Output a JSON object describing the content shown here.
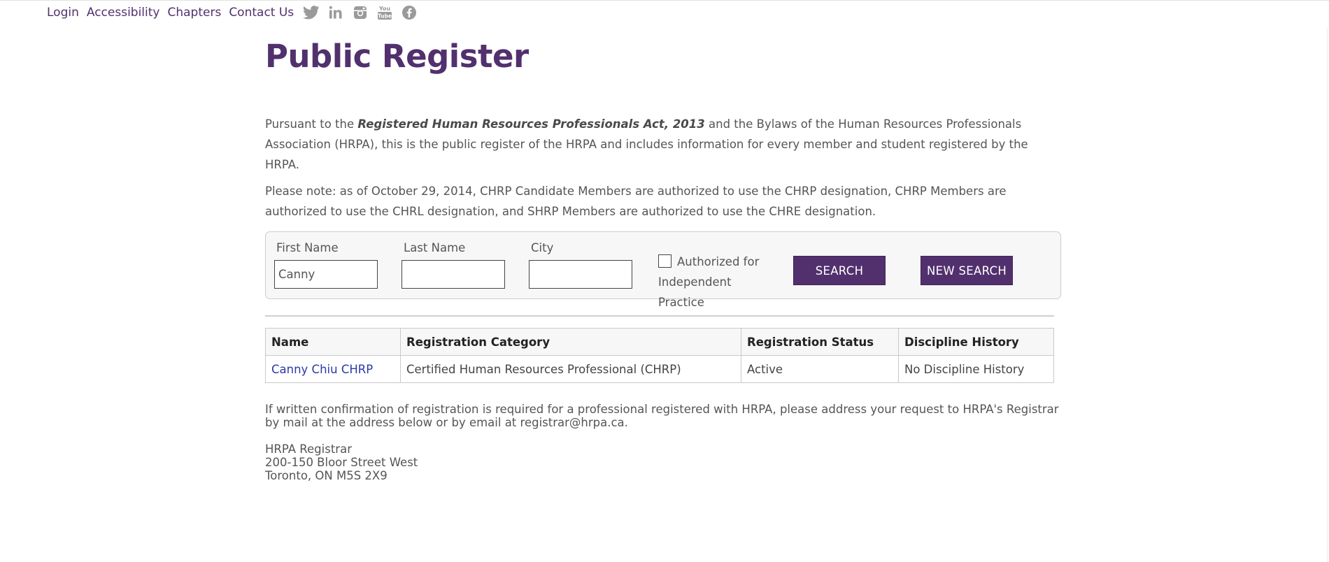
{
  "topnav": {
    "links": [
      "Login",
      "Accessibility",
      "Chapters",
      "Contact Us"
    ],
    "social_icons": [
      "twitter-icon",
      "linkedin-icon",
      "instagram-icon",
      "youtube-icon",
      "facebook-icon"
    ],
    "youtube_text_top": "You",
    "youtube_text_bottom": "Tube"
  },
  "title": "Public Register",
  "intro": {
    "p1_pre": "Pursuant to the ",
    "p1_act": "Registered Human Resources Professionals Act, 2013",
    "p1_post": " and the Bylaws of the Human Resources Professionals Association (HRPA), this is the public register of the HRPA and includes information for every member and student registered by the HRPA.",
    "p2": "Please note: as of October 29, 2014, CHRP Candidate Members are authorized to use the CHRP designation, CHRP Members are authorized to use the CHRL designation, and SHRP Members are authorized to use the CHRE designation."
  },
  "search": {
    "first_name_label": "First Name",
    "first_name_value": "Canny",
    "last_name_label": "Last Name",
    "last_name_value": "",
    "city_label": "City",
    "city_value": "",
    "checkbox_label": "Authorized for Independent Practice",
    "checkbox_checked": false,
    "search_button": "SEARCH",
    "new_search_button": "NEW SEARCH"
  },
  "results": {
    "headers": [
      "Name",
      "Registration Category",
      "Registration Status",
      "Discipline History"
    ],
    "rows": [
      {
        "name": "Canny Chiu CHRP",
        "category": "Certified Human Resources Professional (CHRP)",
        "status": "Active",
        "discipline": "No Discipline History"
      }
    ]
  },
  "footer_note": "If written confirmation of registration is required for a professional registered with HRPA, please address your request to HRPA's Registrar by mail at the address below or by email at registrar@hrpa.ca.",
  "address": {
    "line1": "HRPA Registrar",
    "line2": "200-150 Bloor Street West",
    "line3": "Toronto, ON M5S 2X9"
  },
  "colors": {
    "brand": "#52306e",
    "link": "#2a3aa8",
    "icon_gray": "#9a9a9a"
  }
}
